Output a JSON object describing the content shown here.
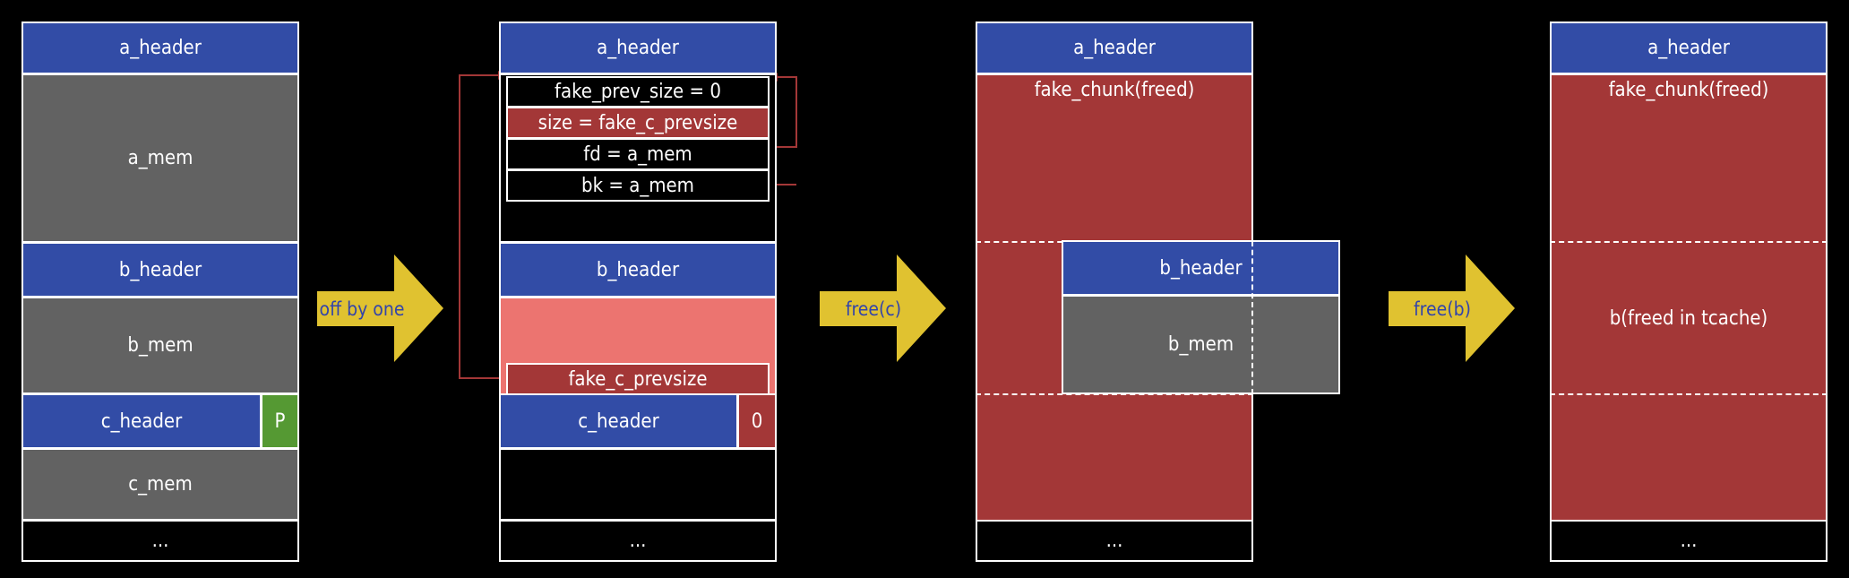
{
  "colors": {
    "header": "#324ca6",
    "mem": "#626262",
    "freed": "#a33737",
    "overflow": "#ec7470",
    "prev_inuse": "#559933",
    "arrow": "#e0c230",
    "pointer": "#a33737"
  },
  "stage1": {
    "a_header": "a_header",
    "a_mem": "a_mem",
    "b_header": "b_header",
    "b_mem": "b_mem",
    "c_header": "c_header",
    "flag": "P",
    "c_mem": "c_mem",
    "more": "..."
  },
  "step1": {
    "label": "off by one"
  },
  "stage2": {
    "a_header": "a_header",
    "fake_prev_size": "fake_prev_size = 0",
    "size": "size = fake_c_prevsize",
    "fd": "fd = a_mem",
    "bk": "bk = a_mem",
    "b_header": "b_header",
    "fake_c_prevsize": "fake_c_prevsize",
    "c_header": "c_header",
    "flag": "0",
    "more": "..."
  },
  "step2": {
    "label": "free(c)"
  },
  "stage3": {
    "a_header": "a_header",
    "fake_chunk": "fake_chunk(freed)",
    "b_header": "b_header",
    "b_mem": "b_mem",
    "more": "..."
  },
  "step3": {
    "label": "free(b)"
  },
  "stage4": {
    "a_header": "a_header",
    "fake_chunk": "fake_chunk(freed)",
    "b_freed": "b(freed in tcache)",
    "more": "..."
  }
}
